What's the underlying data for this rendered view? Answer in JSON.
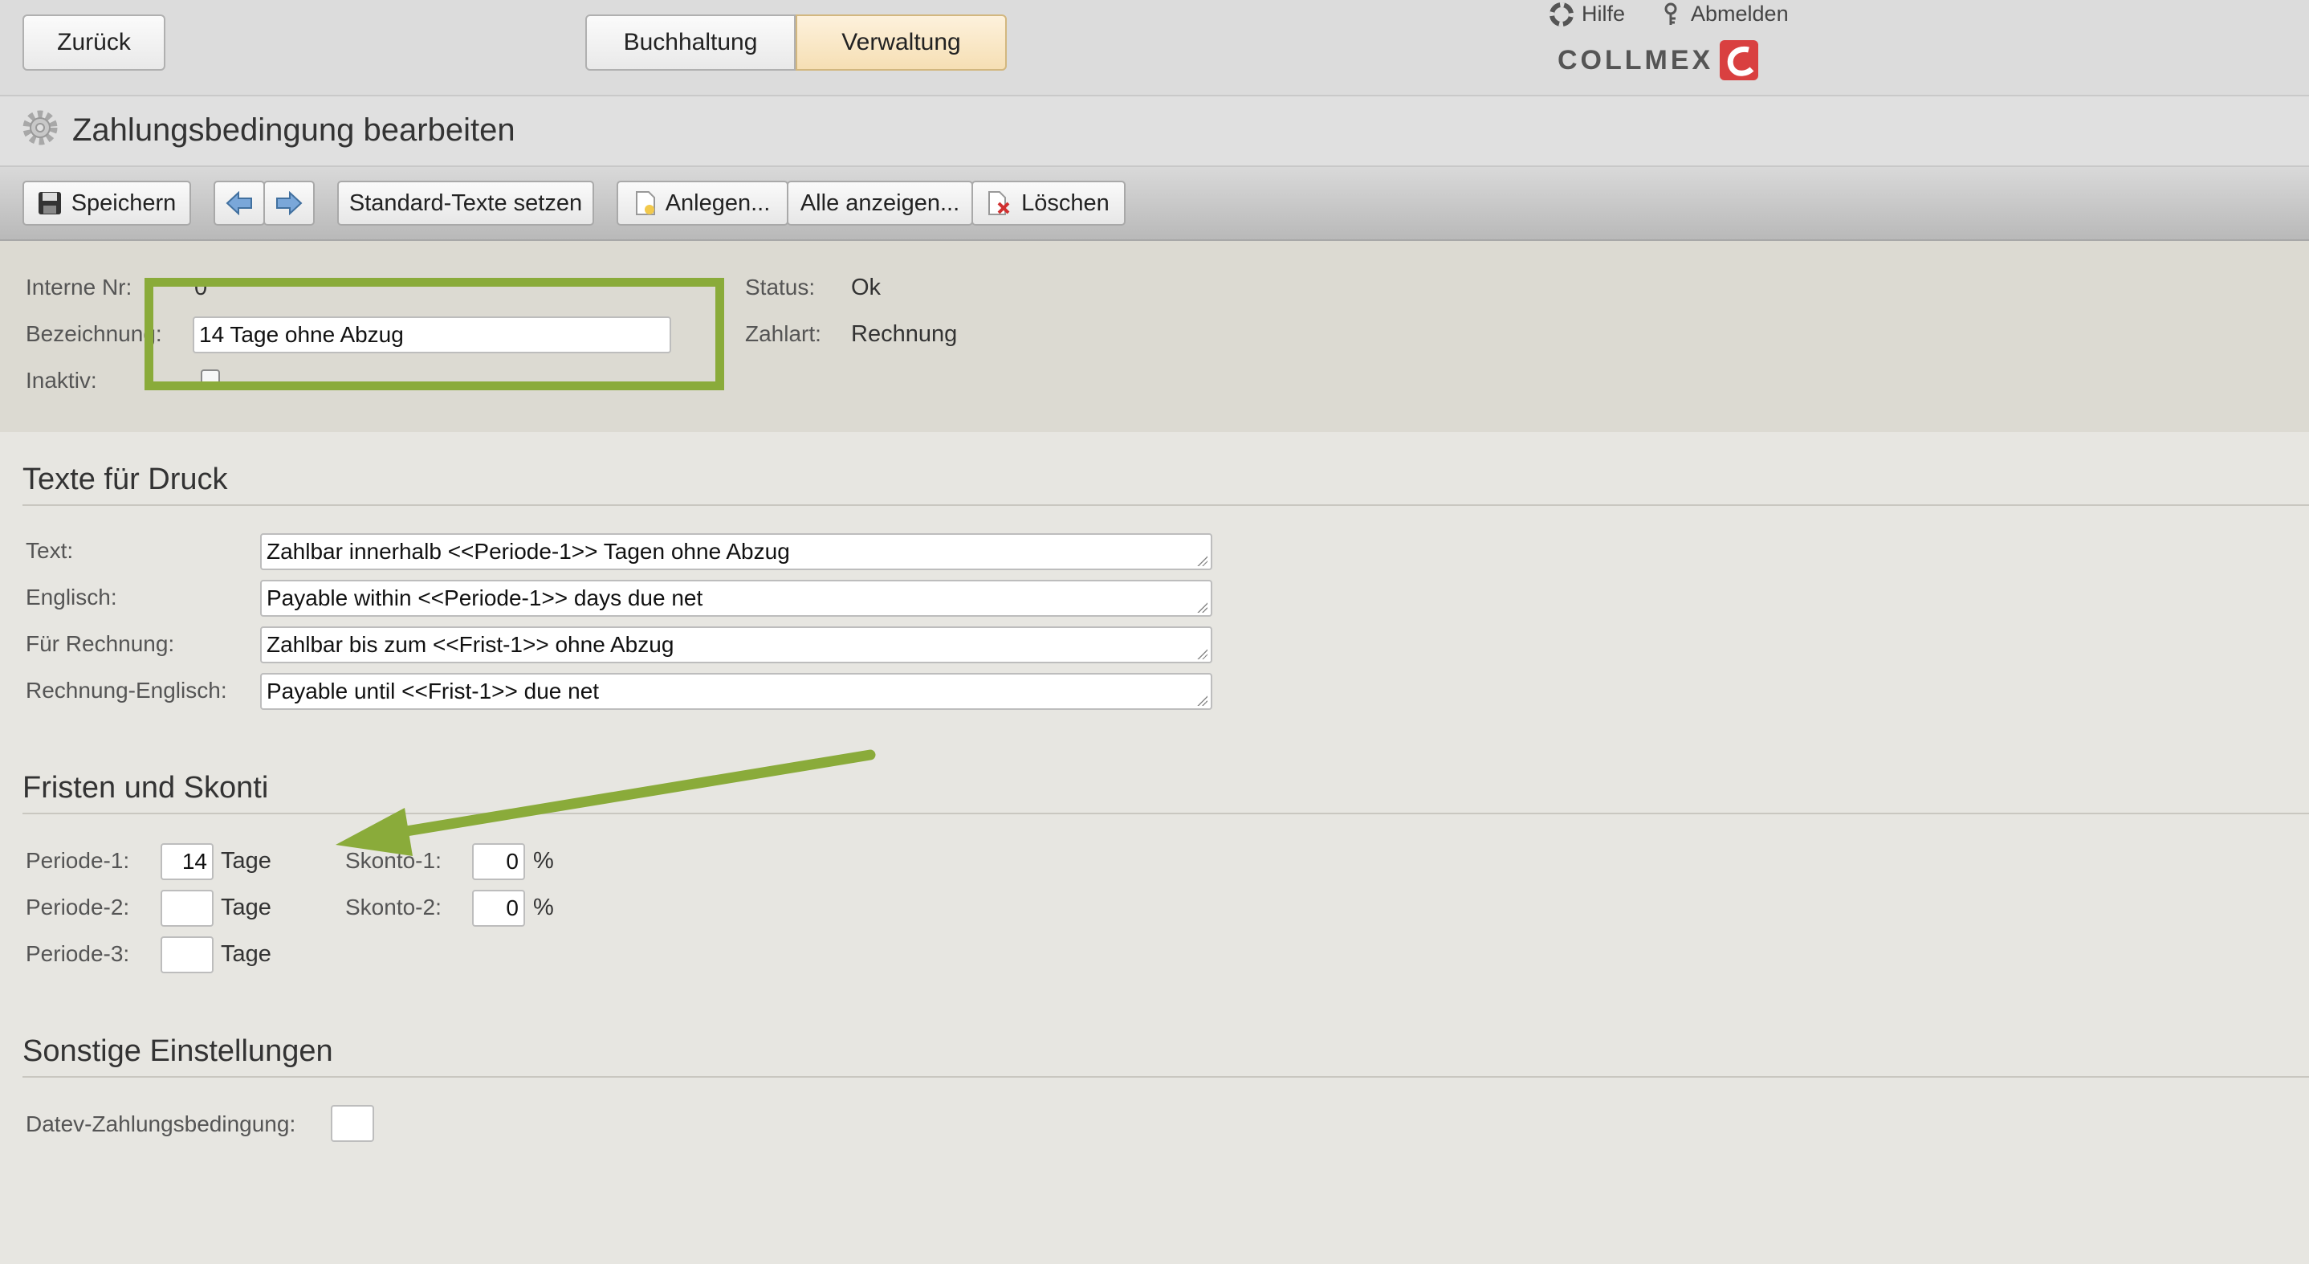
{
  "nav": {
    "back": "Zurück",
    "tabs": [
      "Buchhaltung",
      "Verwaltung"
    ],
    "help": "Hilfe",
    "logout": "Abmelden",
    "logo": "COLLMEX"
  },
  "page": {
    "title": "Zahlungsbedingung bearbeiten"
  },
  "toolbar": {
    "save": "Speichern",
    "standard_texts": "Standard-Texte setzen",
    "create": "Anlegen...",
    "show_all": "Alle anzeigen...",
    "delete": "Löschen"
  },
  "header": {
    "internal_nr_label": "Interne Nr:",
    "internal_nr_value": "0",
    "name_label": "Bezeichnung:",
    "name_value": "14 Tage ohne Abzug",
    "inactive_label": "Inaktiv:",
    "status_label": "Status:",
    "status_value": "Ok",
    "payment_type_label": "Zahlart:",
    "payment_type_value": "Rechnung"
  },
  "print_texts": {
    "title": "Texte für Druck",
    "rows": [
      {
        "label": "Text:",
        "value": "Zahlbar innerhalb <<Periode-1>> Tagen ohne Abzug"
      },
      {
        "label": "Englisch:",
        "value": "Payable within <<Periode-1>> days due net"
      },
      {
        "label": "Für Rechnung:",
        "value": "Zahlbar bis zum <<Frist-1>> ohne Abzug"
      },
      {
        "label": "Rechnung-Englisch:",
        "value": "Payable until <<Frist-1>> due net"
      }
    ]
  },
  "terms": {
    "title": "Fristen und Skonti",
    "unit_days": "Tage",
    "unit_percent": "%",
    "periods": [
      {
        "label": "Periode-1:",
        "value": "14"
      },
      {
        "label": "Periode-2:",
        "value": ""
      },
      {
        "label": "Periode-3:",
        "value": ""
      }
    ],
    "discounts": [
      {
        "label": "Skonto-1:",
        "value": "0"
      },
      {
        "label": "Skonto-2:",
        "value": "0"
      }
    ]
  },
  "other": {
    "title": "Sonstige Einstellungen",
    "datev_label": "Datev-Zahlungsbedingung:",
    "datev_value": ""
  },
  "annotation_color": "#8aab3a"
}
